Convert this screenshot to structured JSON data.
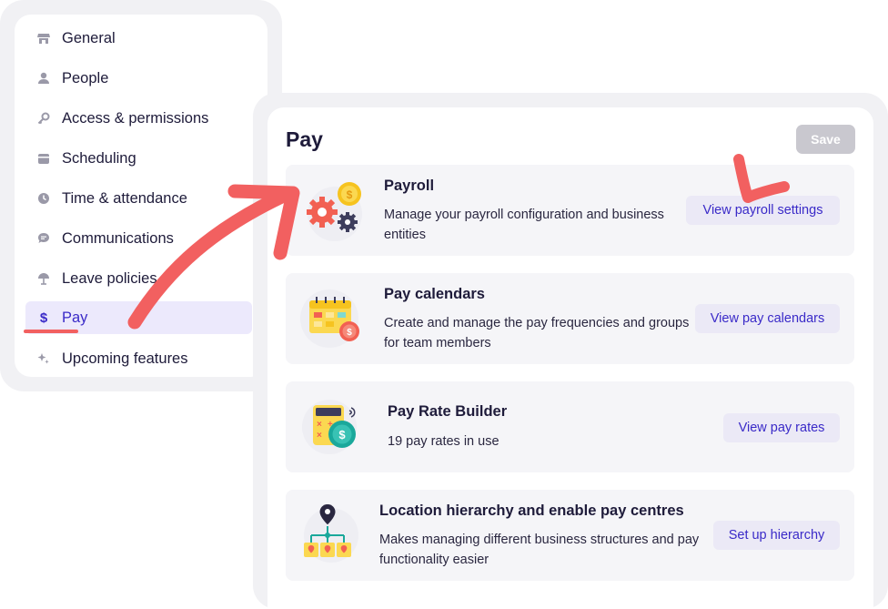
{
  "sidebar": {
    "items": [
      {
        "label": "General",
        "icon": "store-icon"
      },
      {
        "label": "People",
        "icon": "person-icon"
      },
      {
        "label": "Access & permissions",
        "icon": "key-icon"
      },
      {
        "label": "Scheduling",
        "icon": "calendar-icon"
      },
      {
        "label": "Time & attendance",
        "icon": "clock-icon"
      },
      {
        "label": "Communications",
        "icon": "chat-icon"
      },
      {
        "label": "Leave policies",
        "icon": "umbrella-icon"
      },
      {
        "label": "Pay",
        "icon": "dollar-icon",
        "active": true
      },
      {
        "label": "Upcoming features",
        "icon": "sparkle-icon"
      }
    ]
  },
  "main": {
    "title": "Pay",
    "save_label": "Save",
    "cards": [
      {
        "title": "Payroll",
        "description": "Manage your payroll configuration and business entities",
        "button": "View payroll settings",
        "icon": "payroll-gears-icon"
      },
      {
        "title": "Pay calendars",
        "description": "Create and manage the pay frequencies and groups for team members",
        "button": "View pay calendars",
        "icon": "pay-calendar-icon"
      },
      {
        "title": "Pay Rate Builder",
        "description": "19 pay rates in use",
        "button": "View pay rates",
        "icon": "calculator-icon"
      },
      {
        "title": "Location hierarchy and enable pay centres",
        "description": "Makes managing different business structures and pay functionality easier",
        "button": "Set up hierarchy",
        "icon": "location-hierarchy-icon"
      }
    ]
  },
  "colors": {
    "accent": "#3a2ac8",
    "active_bg": "#ece9fc",
    "annotation": "#f26060",
    "save_disabled": "#c9c8cf"
  }
}
